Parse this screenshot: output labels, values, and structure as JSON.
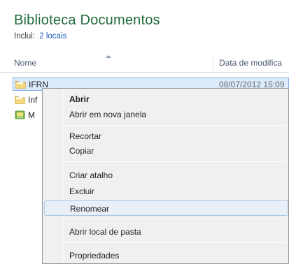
{
  "library": {
    "title": "Biblioteca Documentos",
    "includes_label": "Inclui:",
    "includes_link": "2 locais"
  },
  "columns": {
    "name": "Nome",
    "date": "Data de modifica"
  },
  "files": [
    {
      "name": "IFRN",
      "date": "08/07/2012 15:09",
      "icon": "folder-icon",
      "selected": true
    },
    {
      "name": "Inf",
      "date": "",
      "icon": "folder-icon",
      "selected": false
    },
    {
      "name": "M",
      "date": "",
      "icon": "library-icon",
      "selected": false
    }
  ],
  "context_menu": {
    "open": "Abrir",
    "open_new_window": "Abrir em nova janela",
    "cut": "Recortar",
    "copy": "Copiar",
    "create_shortcut": "Criar atalho",
    "delete": "Excluir",
    "rename": "Renomear",
    "open_folder_location": "Abrir local de pasta",
    "properties": "Propriedades",
    "highlighted": "Renomear"
  },
  "colors": {
    "title_green": "#1e6b39",
    "link_blue": "#1a5fb4",
    "selection": "#dcebfc",
    "menu_bg": "#f0f0f0"
  }
}
